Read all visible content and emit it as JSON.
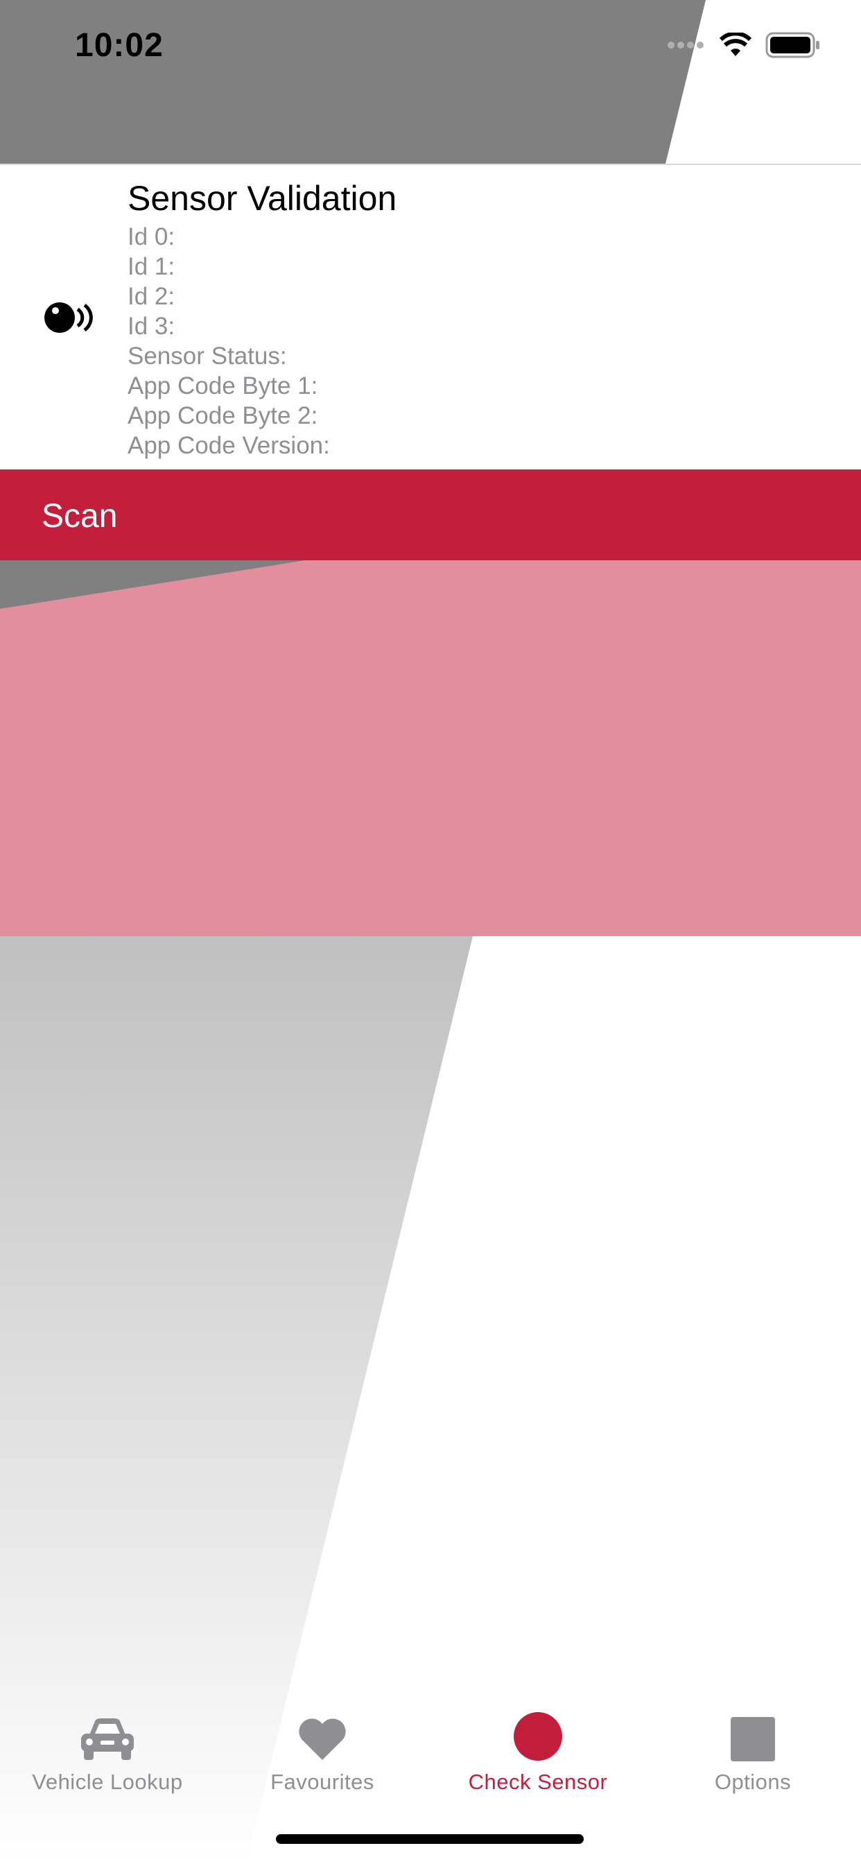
{
  "status_bar": {
    "time": "10:02"
  },
  "sensor_card": {
    "title": "Sensor Validation",
    "fields": [
      "Id 0:",
      "Id 1:",
      "Id 2:",
      "Id 3:",
      "Sensor Status:",
      "App Code Byte 1:",
      "App Code Byte 2:",
      "App Code Version:"
    ]
  },
  "scan": {
    "label": "Scan"
  },
  "tabs": [
    {
      "label": "Vehicle Lookup",
      "icon": "car-icon"
    },
    {
      "label": "Favourites",
      "icon": "heart-icon"
    },
    {
      "label": "Check Sensor",
      "icon": "sensor-dot-icon",
      "active": true
    },
    {
      "label": "Options",
      "icon": "square-icon"
    }
  ],
  "colors": {
    "accent": "#c41e3d",
    "inactive": "#8e8e93",
    "header_grey": "#808080",
    "panel_pink": "#e28e9c"
  }
}
